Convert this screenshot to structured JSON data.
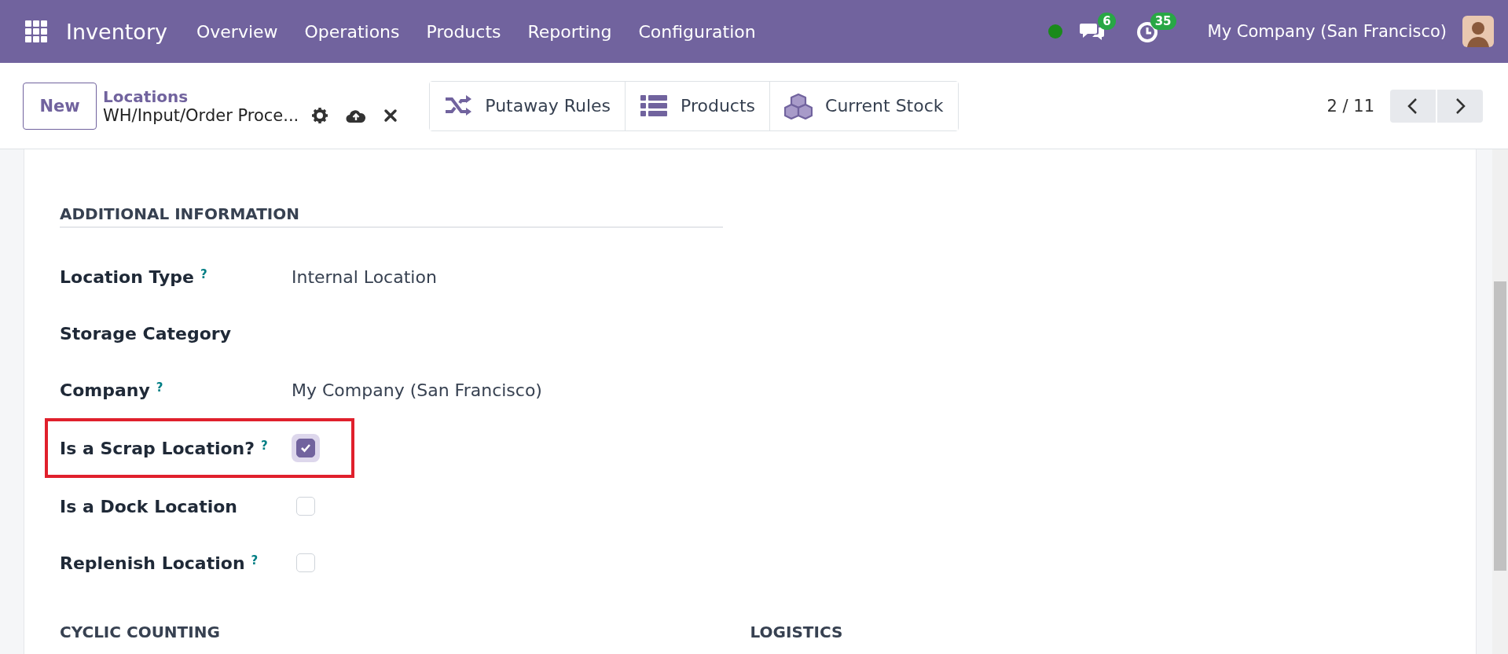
{
  "navbar": {
    "app_name": "Inventory",
    "menu": [
      "Overview",
      "Operations",
      "Products",
      "Reporting",
      "Configuration"
    ],
    "messages_count": "6",
    "activities_count": "35",
    "company": "My Company (San Francisco)"
  },
  "control_panel": {
    "new_button": "New",
    "breadcrumb": "Locations",
    "record_name": "WH/Input/Order Proce...",
    "smart_buttons": [
      {
        "kind": "shuffle",
        "label": "Putaway Rules"
      },
      {
        "kind": "list",
        "label": "Products"
      },
      {
        "kind": "cubes",
        "label": "Current Stock"
      }
    ],
    "pager": "2 / 11"
  },
  "form": {
    "section": {
      "title": "ADDITIONAL INFORMATION",
      "fields": [
        {
          "kind": "text",
          "label": "Location Type",
          "help": "?",
          "value": "Internal Location",
          "highlighted": false
        },
        {
          "kind": "text",
          "label": "Storage Category",
          "highlighted": false
        },
        {
          "kind": "text",
          "label": "Company",
          "help": "?",
          "value": "My Company (San Francisco)",
          "highlighted": false
        },
        {
          "kind": "checkbox",
          "label": "Is a Scrap Location?",
          "help": "?",
          "checked": true,
          "highlighted": true
        },
        {
          "kind": "checkbox",
          "label": "Is a Dock Location",
          "checked": false,
          "highlighted": false
        },
        {
          "kind": "checkbox",
          "label": "Replenish Location",
          "help": "?",
          "checked": false,
          "highlighted": false
        }
      ]
    },
    "next_sections": [
      "CYCLIC COUNTING",
      "LOGISTICS"
    ]
  }
}
